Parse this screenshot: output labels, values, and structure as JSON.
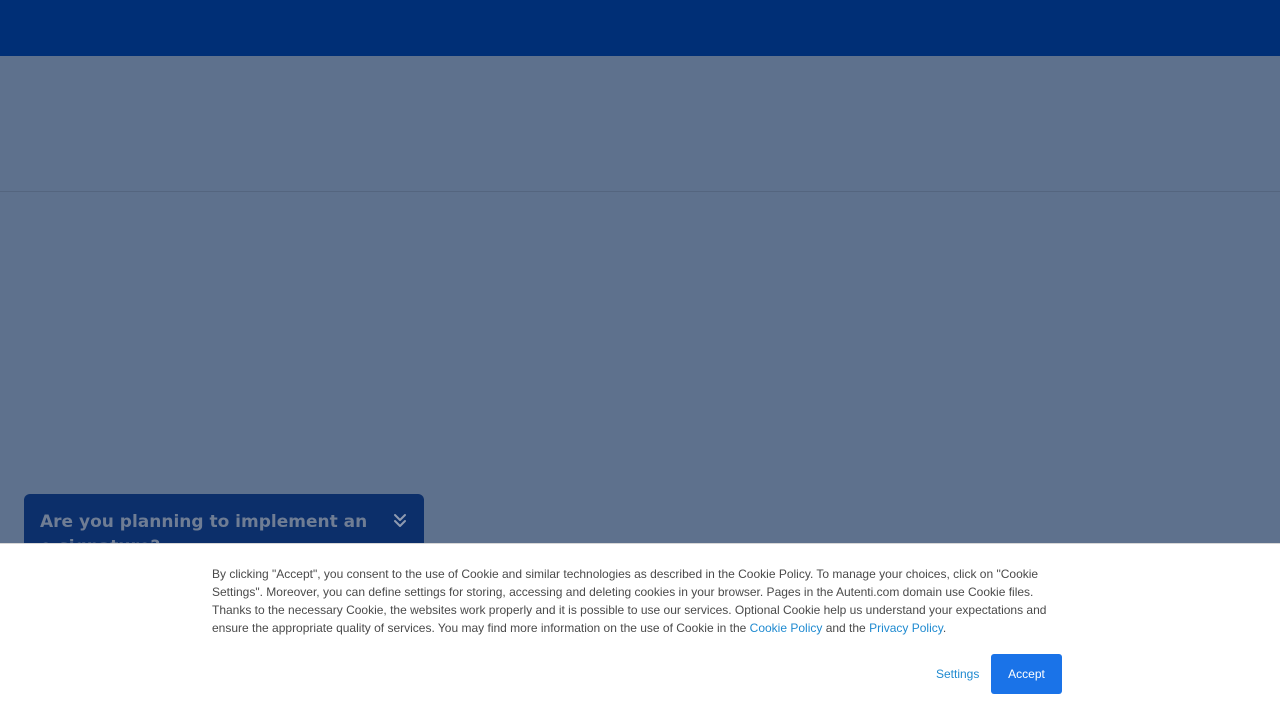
{
  "promo": {
    "title": "Are you planning to implement an e-signature?",
    "toggle_icon": "double-chevron-down-icon"
  },
  "cookie_banner": {
    "text_before": "By clicking \"Accept\", you consent to the use of Cookie and similar technologies as described in the Cookie Policy. To manage your choices, click on \"Cookie Settings\". Moreover, you can define settings for storing, accessing and deleting cookies in your browser. Pages in the Autenti.com domain use Cookie files. Thanks to the necessary Cookie, the websites work properly and it is possible to use our services. Optional Cookie help us understand your expectations and ensure the appropriate quality of services. You may find more information on the use of Cookie in the ",
    "cookie_policy_link": "Cookie Policy",
    "text_between": " and the ",
    "privacy_policy_link": "Privacy Policy",
    "text_after": ".",
    "settings_label": "Settings",
    "accept_label": "Accept"
  },
  "colors": {
    "header": "#002f76",
    "overlay": "#5e718d",
    "accent": "#1a73e8",
    "link": "#1f8ad0"
  }
}
